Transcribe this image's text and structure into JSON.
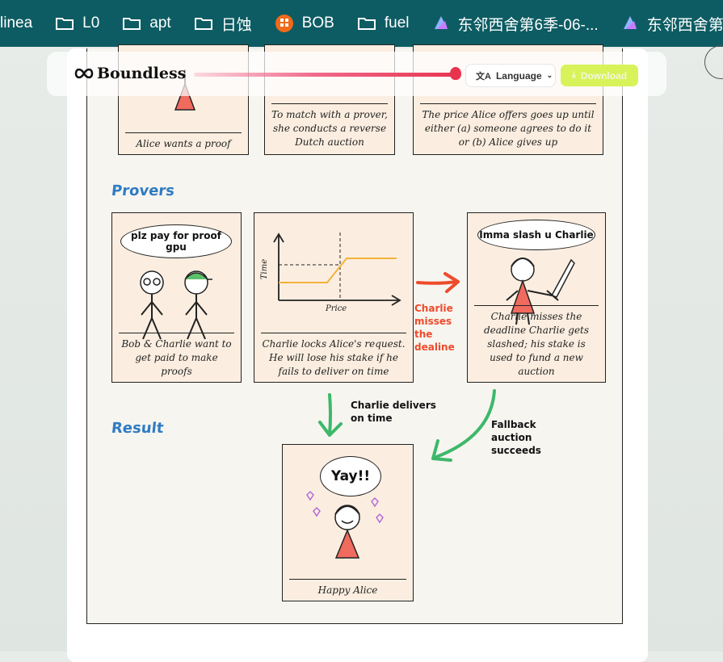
{
  "bookmarks": [
    {
      "label": "linea",
      "icon": "none"
    },
    {
      "label": "L0",
      "icon": "folder-icon"
    },
    {
      "label": "apt",
      "icon": "folder-icon"
    },
    {
      "label": "日蚀",
      "icon": "folder-icon"
    },
    {
      "label": "BOB",
      "icon": "bob-icon"
    },
    {
      "label": "fuel",
      "icon": "folder-icon"
    },
    {
      "label": "东邻西舍第6季-06-...",
      "icon": "app-icon"
    },
    {
      "label": "东邻西舍第6",
      "icon": "app-icon"
    }
  ],
  "header": {
    "brand": "Boundless",
    "language_label": "Language",
    "download_label": "Download",
    "reading_progress": 0.95
  },
  "comic": {
    "top_captions": [
      "Alice wants a proof",
      "To match with a prover, she conducts a reverse Dutch auction",
      "The price Alice offers goes up until either (a) someone agrees to do it or (b) Alice gives up"
    ],
    "provers_title": "Provers",
    "bob_charlie_bubble": "plz pay for proof gpu",
    "bob_charlie_caption": "Bob & Charlie want to get paid to make proofs",
    "graph_ylabel": "Time",
    "graph_xlabel": "Price",
    "lock_caption": "Charlie locks Alice's request. He will lose his stake if he fails to deliver on time",
    "miss_note": "Charlie misses the dealine",
    "slash_bubble": "Imma slash u Charlie",
    "slash_caption": "Charlie misses the deadline Charlie gets slashed; his stake is used to fund a new auction",
    "result_title": "Result",
    "delivers_note": "Charlie delivers on time",
    "fallback_note": "Fallback auction succeeds",
    "yay_bubble": "Yay!!",
    "happy_caption": "Happy Alice"
  },
  "colors": {
    "bookmark_bar": "#0d5c63",
    "section_title": "#2f7cc3",
    "panel_fill": "#fbeee0",
    "red_arrow": "#ee4b2b",
    "green_arrow": "#3db86a",
    "download_button": "#d8f25a"
  }
}
